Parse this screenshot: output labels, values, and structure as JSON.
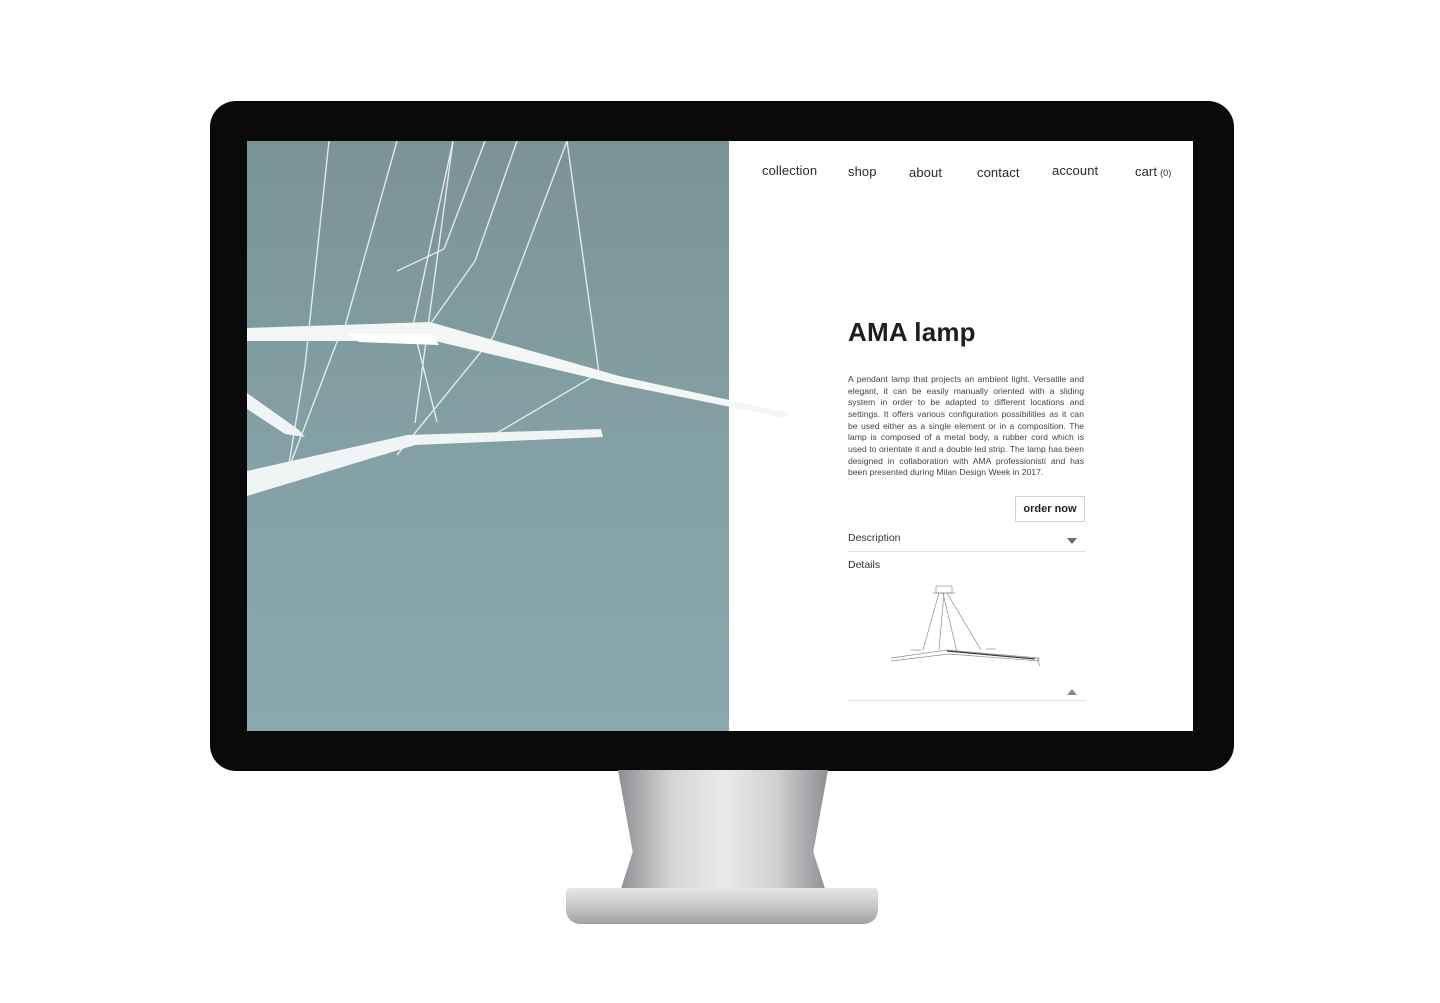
{
  "nav": {
    "collection": "collection",
    "shop": "shop",
    "about": "about",
    "contact": "contact",
    "account": "account",
    "cart_label": "cart",
    "cart_count": "(0)"
  },
  "product": {
    "title": "AMA lamp",
    "description": "A pendant lamp that projects an ambient light. Versatile and elegant, it can be easily manually oriented with a sliding system in order to be adapted to different locations and settings. It offers various configuration possibilities as it can be used either as a single element or in a composition. The lamp is composed of a metal body, a rubber cord which is used to orientate it and a double led strip. The lamp has been designed in collaboration with AMA professionisti and has been presented during Milan Design Week in 2017.",
    "order_label": "order now"
  },
  "accordion": {
    "description_label": "Description",
    "details_label": "Details"
  },
  "colors": {
    "bezel": "#0a0a0a",
    "photo_background": "#84a1a5",
    "lamp": "#f4f6f6",
    "text": "#2a2a2a"
  },
  "icons": {
    "description_toggle": "caret-down-icon",
    "details_toggle": "caret-up-icon"
  }
}
